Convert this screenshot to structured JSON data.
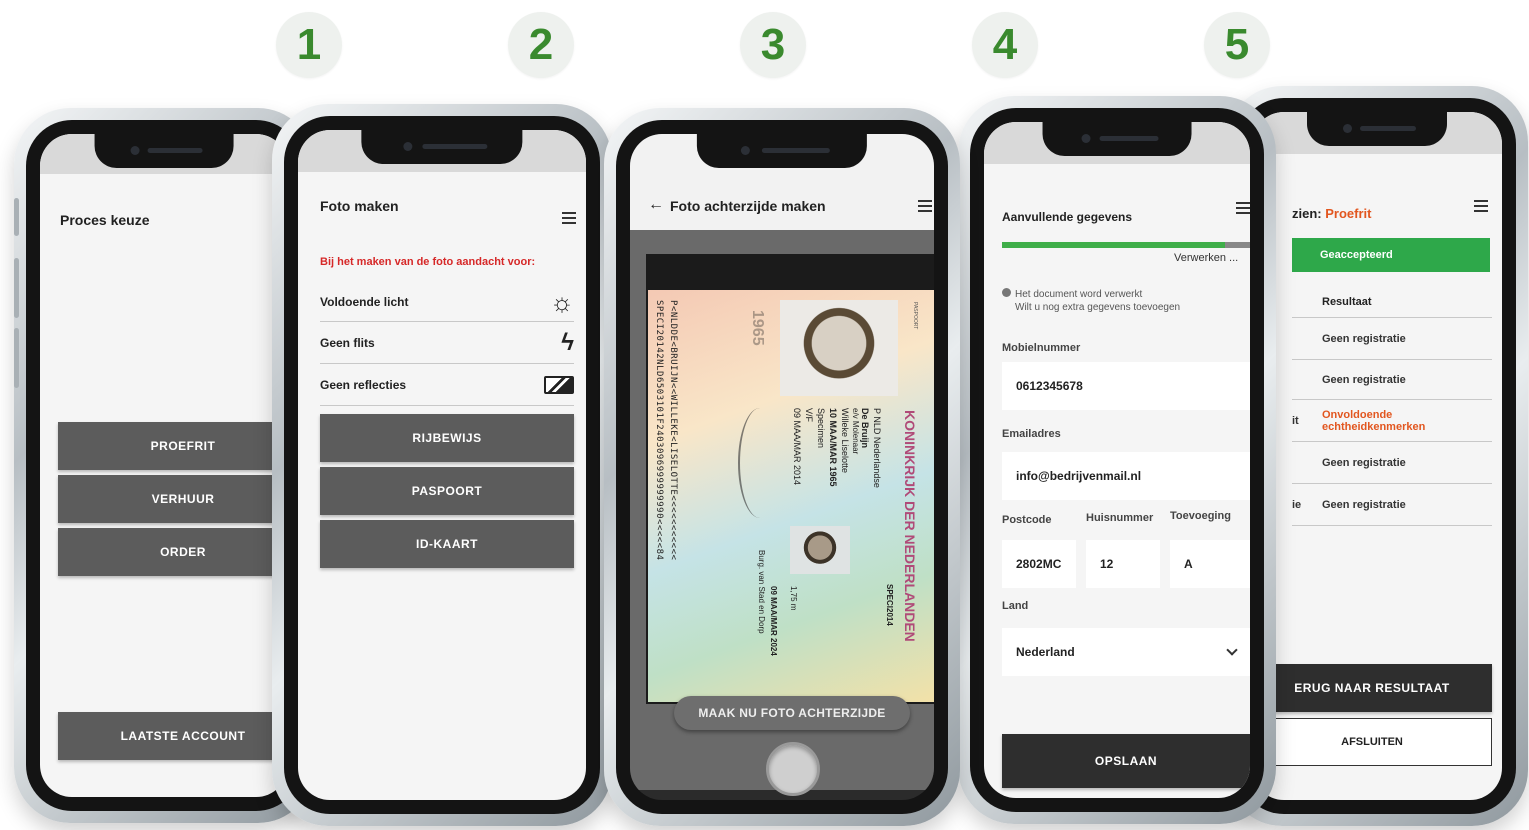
{
  "steps": [
    "1",
    "2",
    "3",
    "4",
    "5"
  ],
  "colors": {
    "accent_green": "#3a8a2e",
    "warning_red": "#d62828",
    "orange": "#e2561f",
    "button_gray": "#5c5c5c",
    "button_dark": "#2e2e2e"
  },
  "phone1": {
    "title": "Proces keuze",
    "buttons": [
      "PROEFRIT",
      "VERHUUR",
      "ORDER"
    ],
    "bottom_button": "LAATSTE ACCOUNT"
  },
  "phone2": {
    "title": "Foto maken",
    "menu_icon": "hamburger-icon",
    "warning": "Bij het maken van de foto aandacht voor:",
    "checks": [
      {
        "label": "Voldoende licht",
        "icon": "sun-icon"
      },
      {
        "label": "Geen flits",
        "icon": "no-flash-icon"
      },
      {
        "label": "Geen reflecties",
        "icon": "reflection-icon"
      }
    ],
    "buttons": [
      "RIJBEWIJS",
      "PASPOORT",
      "ID-KAART"
    ]
  },
  "phone3": {
    "title": "Foto achterzijde maken",
    "back_icon": "arrow-left-icon",
    "capture_button": "MAAK NU FOTO ACHTERZIJDE",
    "passport": {
      "country": "KONINKRIJK DER NEDERLANDEN",
      "doc_type": "PASPOORT",
      "code": "SPECI2014",
      "type": "P",
      "nationality_code": "NLD",
      "nationality": "Nederlandse",
      "surname": "De Bruijn",
      "spouse": "e/v Molenaar",
      "given_names": "Willeke Liselotte",
      "birth_date": "10 MAA/MAR 1965",
      "birth_place": "Specimen",
      "sex": "V/F",
      "issue_date": "09 MAA/MAR 2014",
      "expiry_date": "09 MAA/MAR 2024",
      "height": "1,75 m",
      "authority": "Burg. van Stad en Dorp",
      "year_mark": "1965",
      "mrz_line1": "P<NLDDE<BRUIJN<<WILLEKE<LISELOTTE<<<<<<<<<<<",
      "mrz_line2": "SPECI20142NLD6503101F2403096999999990<<<<<84"
    }
  },
  "phone4": {
    "title": "Aanvullende gegevens",
    "progress_label": "Verwerken ...",
    "progress_fraction": 0.9,
    "info_line1": "Het document word verwerkt",
    "info_line2": "Wilt u nog extra gegevens toevoegen",
    "mobile_label": "Mobielnummer",
    "mobile_value": "0612345678",
    "email_label": "Emailadres",
    "email_value": "info@bedrijvenmail.nl",
    "postcode_label": "Postcode",
    "postcode_value": "2802MC",
    "housenumber_label": "Huisnummer",
    "housenumber_value": "12",
    "addition_label": "Toevoeging",
    "addition_value": "A",
    "country_label": "Land",
    "country_value": "Nederland",
    "save_button": "OPSLAAN"
  },
  "phone5": {
    "title_prefix": "zien:",
    "title_value": "Proefrit",
    "status": "Geaccepteerd",
    "result_header": "Resultaat",
    "rows": [
      "Geen registratie",
      "Geen registratie",
      "Onvoldoende echtheidkenmerken",
      "Geen registratie",
      "Geen registratie"
    ],
    "row_left_labels": [
      "",
      "",
      "it",
      "",
      "ie"
    ],
    "back_button": "ERUG NAAR RESULTAAT",
    "close_button": "AFSLUITEN"
  }
}
